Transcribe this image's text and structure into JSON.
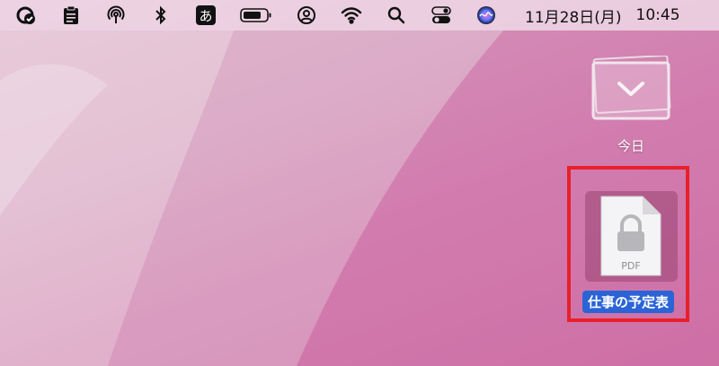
{
  "menubar": {
    "ime_char": "あ",
    "date": "11月28日(月)",
    "time": "10:45",
    "icons": [
      "checkmark-badge-icon",
      "clipboard-icon",
      "airdrop-icon",
      "bluetooth-icon",
      "input-method-icon",
      "battery-icon",
      "user-account-icon",
      "wifi-icon",
      "spotlight-search-icon",
      "control-center-icon",
      "siri-icon"
    ]
  },
  "desktop": {
    "stack": {
      "label": "今日"
    },
    "file": {
      "name": "仕事の予定表",
      "type_label": "PDF"
    }
  },
  "colors": {
    "highlight_border": "#e8202a",
    "selection": "#2b64d6",
    "wallpaper": "#d88cb8"
  }
}
